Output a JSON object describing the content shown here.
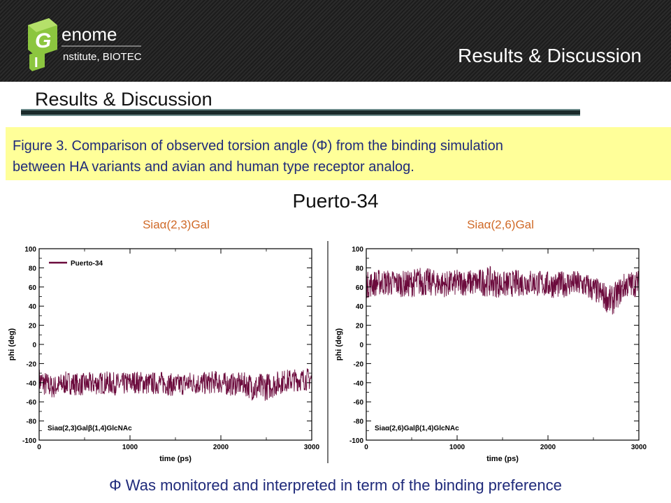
{
  "header": {
    "logo_letters": [
      "G",
      "I"
    ],
    "logo_text_line1": "enome",
    "logo_text_line2": "nstitute, BIOTEC",
    "title": "Results & Discussion"
  },
  "section_title": "Results & Discussion",
  "caption": {
    "line1": "Figure 3. Comparison of observed torsion angle (Φ) from the binding simulation",
    "line2": "between HA variants and avian and human type receptor analog."
  },
  "main_title": "Puerto-34",
  "footer": "Φ Was monitored and interpreted in term of the binding preference",
  "colors": {
    "series": "#6b0a3c",
    "caption_bg": "#ffff99",
    "caption_text": "#1f2a7a",
    "sublabel": "#d06a28"
  },
  "chart_data": [
    {
      "type": "line",
      "subtitle": "Siaα(2,3)Gal",
      "xlabel": "time (ps)",
      "ylabel": "phi (deg)",
      "xlim": [
        0,
        3000
      ],
      "ylim": [
        -100,
        100
      ],
      "xticks": [
        0,
        1000,
        2000,
        3000
      ],
      "yticks": [
        -100,
        -80,
        -60,
        -40,
        -20,
        0,
        20,
        40,
        60,
        80,
        100
      ],
      "legend": {
        "entries": [
          "Puerto-34"
        ],
        "position": "top-left"
      },
      "annotation": "Siaα(2,3)Galβ(1,4)GlcNAc",
      "series": [
        {
          "name": "Puerto-34",
          "x": [
            0,
            150,
            300,
            450,
            600,
            750,
            900,
            1050,
            1200,
            1350,
            1500,
            1650,
            1800,
            1950,
            2100,
            2250,
            2400,
            2550,
            2700,
            2850,
            3000
          ],
          "y": [
            -38,
            -45,
            -40,
            -42,
            -41,
            -40,
            -42,
            -39,
            -41,
            -40,
            -43,
            -40,
            -41,
            -39,
            -42,
            -41,
            -46,
            -43,
            -38,
            -37,
            -36
          ],
          "band": [
            14,
            12,
            12,
            12,
            12,
            12,
            12,
            12,
            12,
            12,
            12,
            12,
            12,
            12,
            12,
            12,
            16,
            14,
            12,
            12,
            12
          ]
        }
      ]
    },
    {
      "type": "line",
      "subtitle": "Siaα(2,6)Gal",
      "xlabel": "time (ps)",
      "ylabel": "phi (deg)",
      "xlim": [
        0,
        3000
      ],
      "ylim": [
        -100,
        100
      ],
      "xticks": [
        0,
        1000,
        2000,
        3000
      ],
      "yticks": [
        -100,
        -80,
        -60,
        -40,
        -20,
        0,
        20,
        40,
        60,
        80,
        100
      ],
      "annotation": "Siaα(2,6)Galβ(1,4)GlcNAc",
      "series": [
        {
          "x": [
            0,
            150,
            300,
            450,
            600,
            750,
            900,
            1050,
            1200,
            1350,
            1500,
            1650,
            1800,
            1950,
            2100,
            2250,
            2400,
            2550,
            2700,
            2850,
            3000
          ],
          "y": [
            62,
            65,
            64,
            63,
            66,
            64,
            63,
            65,
            64,
            66,
            62,
            64,
            65,
            63,
            62,
            64,
            62,
            55,
            45,
            62,
            64
          ],
          "band": [
            14,
            14,
            14,
            14,
            16,
            14,
            14,
            14,
            14,
            16,
            14,
            14,
            14,
            14,
            14,
            14,
            14,
            14,
            16,
            14,
            14
          ]
        }
      ]
    }
  ]
}
